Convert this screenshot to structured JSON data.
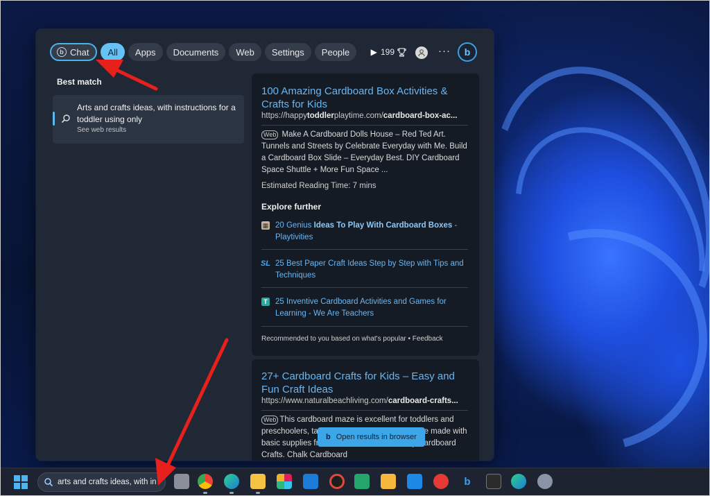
{
  "filters": {
    "chat": "Chat",
    "tabs": [
      "All",
      "Apps",
      "Documents",
      "Web",
      "Settings",
      "People"
    ],
    "points": "199",
    "more": "···"
  },
  "best_match": {
    "label": "Best match",
    "title": "Arts and crafts ideas, with instructions for a toddler using only",
    "subtitle": "See web results"
  },
  "result1": {
    "title": "100 Amazing Cardboard Box Activities & Crafts for Kids",
    "url_prefix": "https://happy",
    "url_bold1": "toddler",
    "url_mid": "playtime.com/",
    "url_bold2": "cardboard-box-ac...",
    "web_tag": "Web",
    "snippet": "Make A Cardboard Dolls House – Red Ted Art. Tunnels and Streets by Celebrate Everyday with Me. Build a Cardboard Box Slide – Everyday Best. DIY Cardboard Space Shuttle + More Fun Space ...",
    "reading_time": "Estimated Reading Time: 7 mins",
    "explore_label": "Explore further",
    "explore": [
      {
        "icon": "image-icon",
        "pre": "20 Genius ",
        "bold": "Ideas To Play With Cardboard Boxes",
        "post": " - Playtivities"
      },
      {
        "icon": "sl-icon",
        "pre": "25 Best Paper Craft Ideas Step by Step with Tips and Techniques",
        "bold": "",
        "post": ""
      },
      {
        "icon": "t-icon",
        "pre": "25 Inventive Cardboard Activities and Games for Learning - We Are Teachers",
        "bold": "",
        "post": ""
      }
    ],
    "recommend": "Recommended to you based on what's popular • Feedback"
  },
  "result2": {
    "title": "27+ Cardboard Crafts for Kids – Easy and Fun Craft Ideas",
    "url_prefix": "https://www.naturalbeachliving.com/",
    "url_bold": "cardboard-crafts...",
    "web_tag": "Web",
    "snippet": "This cardboard maze is excellent for toddlers and preschoolers, ta                                and can be made with basic supplies from around the house. Easy Cardboard Crafts. Chalk Cardboard"
  },
  "open_results": "Open results in browser",
  "taskbar": {
    "search_text": "arts and crafts ideas, with in"
  }
}
